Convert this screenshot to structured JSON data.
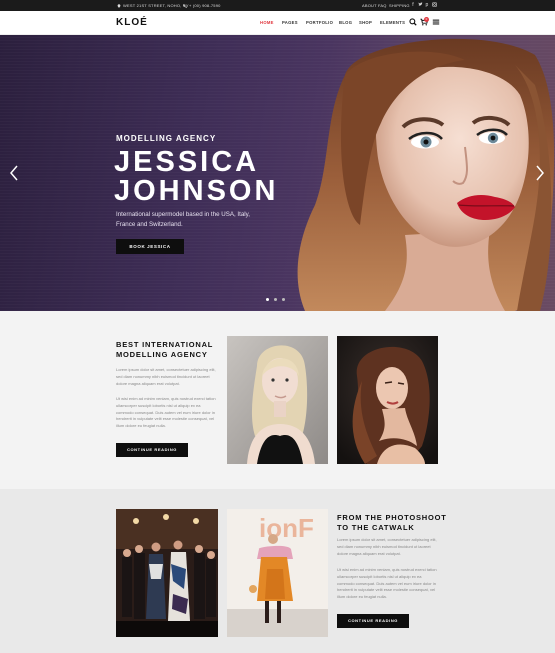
{
  "topbar": {
    "address": "WEST 21ST STREET, NOHO, NY",
    "phone": "+ (00) 908-7590",
    "links": [
      "ABOUT",
      "FAQ",
      "SHIPPING"
    ],
    "social_icons": [
      "facebook-icon",
      "twitter-icon",
      "pinterest-icon",
      "instagram-icon"
    ]
  },
  "header": {
    "logo": "KLOÉ",
    "nav": [
      "HOME",
      "PAGES",
      "PORTFOLIO",
      "BLOG",
      "SHOP",
      "ELEMENTS"
    ],
    "active_nav": "HOME",
    "cart_count": "0",
    "accent": "#e0373f"
  },
  "hero": {
    "kicker": "MODELLING AGENCY",
    "name_line1": "JESSICA",
    "name_line2": "JOHNSON",
    "description": "International supermodel based in the USA, Italy, France and Switzerland.",
    "button": "BOOK JESSICA",
    "slide_count": 3,
    "active_slide": 1
  },
  "section1": {
    "title_line1": "BEST INTERNATIONAL",
    "title_line2": "MODELLING AGENCY",
    "para1": "Lorem ipsum dolor sit amet, consectetuer adipiscing elit, sed diam nonummy nibh euismod tincidunt ut laoreet dolore magna aliquam erat volutpat.",
    "para2": "Ut wisi enim ad minim veniam, quis nostrud exerci tation ullamcorper suscipit lobortis nisl ut aliquip ex ea commodo consequat. Duis autem vel eum iriure dolor in hendrerit in vulputate velit esse molestie consequat, vel illum dolore eu feugiat nulla.",
    "button": "CONTINUE READING"
  },
  "section2": {
    "title_line1": "FROM THE PHOTOSHOOT",
    "title_line2": "TO THE CATWALK",
    "para1": "Lorem ipsum dolor sit amet, consectetuer adipiscing elit, sed diam nonummy nibh euismod tincidunt ut laoreet dolore magna aliquam erat volutpat.",
    "para2": "Ut wisi enim ad minim veniam, quis nostrud exerci tation ullamcorper suscipit lobortis nisl ut aliquip ex ea commodo consequat. Duis autem vel eum iriure dolor in hendrerit in vulputate velit esse molestie consequat, vel illum dolore eu feugiat nulla.",
    "button": "CONTINUE READING",
    "sign_text": "ionF"
  }
}
